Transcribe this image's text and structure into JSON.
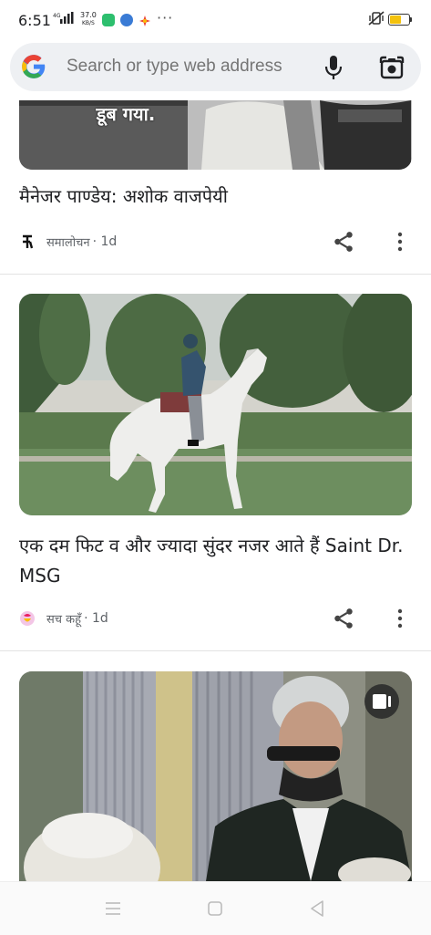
{
  "status_bar": {
    "time": "6:51",
    "network_type": "4G",
    "net_speed_value": "37.0",
    "net_speed_unit": "KB/S",
    "overflow_icon": "more-dots-icon",
    "battery_color": "#f4c20d"
  },
  "search": {
    "placeholder": "Search or type web address"
  },
  "feed": {
    "cards": [
      {
        "image_text": "डूब गया.",
        "headline": "मैनेजर पाण्डेय: अशोक वाजपेयी",
        "source": "समालोचन",
        "age": "· 1d"
      },
      {
        "headline": "एक दम फिट व और ज्यादा सुंदर नजर आते हैं Saint Dr. MSG",
        "source": "सच कहूँ",
        "age": "· 1d"
      },
      {
        "has_video_badge": true
      }
    ]
  },
  "colors": {
    "accent_blue": "#4285f4",
    "accent_red": "#ea4335",
    "accent_yellow": "#fbbc05",
    "accent_green": "#34a853"
  }
}
